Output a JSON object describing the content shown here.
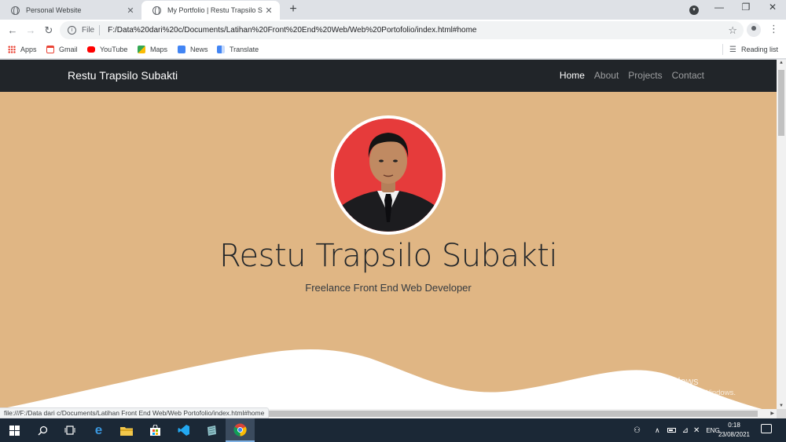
{
  "browser": {
    "tabs": [
      {
        "title": "Personal Website",
        "active": false
      },
      {
        "title": "My Portfolio | Restu Trapsilo Subakti",
        "active": true
      }
    ],
    "new_tab": "+",
    "window_controls": {
      "minimize": "—",
      "restore": "❐",
      "close": "✕"
    },
    "omnibox": {
      "scheme": "File",
      "url": "F:/Data%20dari%20c/Documents/Latihan%20Front%20End%20Web/Web%20Portofolio/index.html#home"
    },
    "bookmarks": [
      {
        "label": "Apps",
        "icon": "apps-grid-icon",
        "color": "#4285f4"
      },
      {
        "label": "Gmail",
        "icon": "gmail-icon",
        "color": "#ea4335"
      },
      {
        "label": "YouTube",
        "icon": "youtube-icon",
        "color": "#ff0000"
      },
      {
        "label": "Maps",
        "icon": "maps-icon",
        "color": "#34a853"
      },
      {
        "label": "News",
        "icon": "news-icon",
        "color": "#4285f4"
      },
      {
        "label": "Translate",
        "icon": "translate-icon",
        "color": "#4285f4"
      }
    ],
    "reading_list": "Reading list",
    "status_url": "file:///F:/Data dari c/Documents/Latihan Front End Web/Web Portofolio/index.html#home"
  },
  "page": {
    "brand": "Restu Trapsilo Subakti",
    "nav": [
      {
        "label": "Home",
        "active": true
      },
      {
        "label": "About",
        "active": false
      },
      {
        "label": "Projects",
        "active": false
      },
      {
        "label": "Contact",
        "active": false
      }
    ],
    "hero_name": "Restu Trapsilo Subakti",
    "hero_subtitle": "Freelance Front End Web Developer",
    "colors": {
      "navbar": "#212529",
      "hero_bg": "#e0b684",
      "avatar_bg": "#e63b3b"
    }
  },
  "windows": {
    "watermark_title": "Activate Windows",
    "watermark_sub": "Go to Settings to activate Windows.",
    "tray_lang": "ENG",
    "time": "0:18",
    "date": "23/08/2021"
  }
}
